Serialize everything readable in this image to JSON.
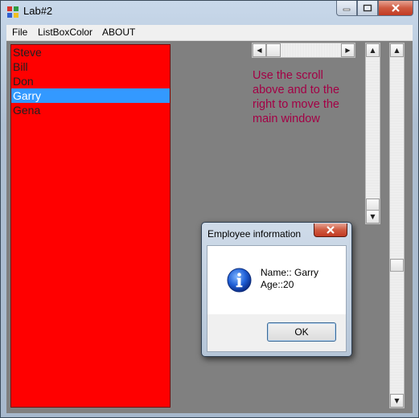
{
  "window": {
    "title": "Lab#2"
  },
  "menu": {
    "items": [
      "File",
      "ListBoxColor",
      "ABOUT"
    ]
  },
  "listbox": {
    "items": [
      "Steve",
      "Bill",
      "Don",
      "Garry",
      "Gena"
    ],
    "selected": "Garry",
    "background": "#ff0000",
    "selection_color": "#3399ff"
  },
  "hint": {
    "text": "Use the scroll above and to the right to move the main window",
    "color": "#a30045"
  },
  "scrollbars": {
    "horizontal": {
      "left_arrow": "◀",
      "right_arrow": "▶"
    },
    "vertical_short": {
      "up_arrow": "▲",
      "down_arrow": "▼"
    },
    "vertical_long": {
      "up_arrow": "▲",
      "down_arrow": "▼"
    }
  },
  "dialog": {
    "title": "Employee information",
    "name_line": "Name:: Garry",
    "age_line": "Age::20",
    "ok_label": "OK",
    "icon": "info-icon"
  },
  "colors": {
    "client_background": "#808080"
  }
}
